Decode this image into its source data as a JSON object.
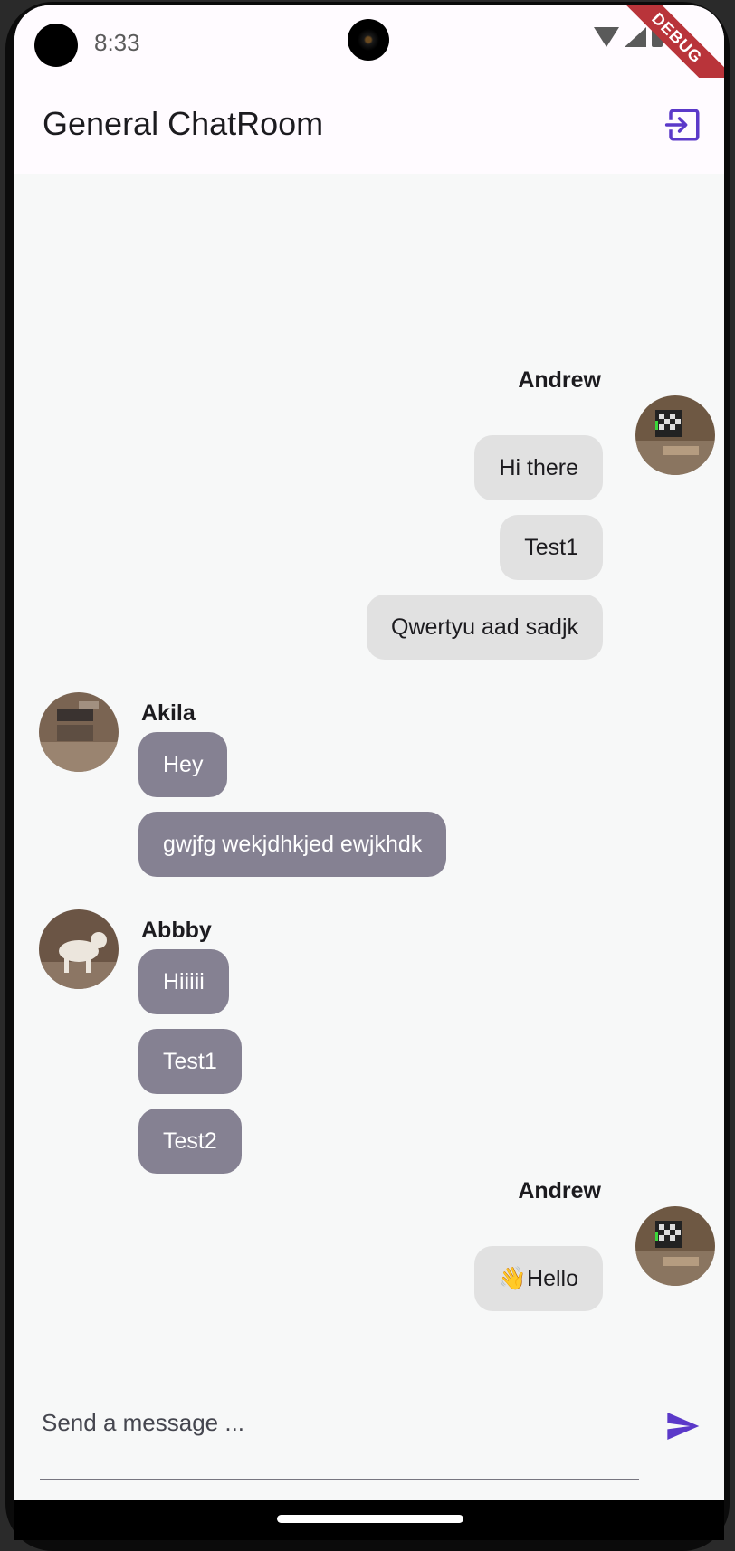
{
  "status_bar": {
    "time": "8:33",
    "debug_label": "DEBUG"
  },
  "app_bar": {
    "title": "General ChatRoom",
    "logout_icon": "logout-icon",
    "accent_color": "#5b39c9"
  },
  "messages": {
    "group1": {
      "sender": "Andrew",
      "texts": [
        "Hi there",
        "Test1",
        "Qwertyu aad sadjk"
      ]
    },
    "group2": {
      "sender": "Akila",
      "texts": [
        "Hey",
        "gwjfg wekjdhkjed ewjkhdk"
      ]
    },
    "group3": {
      "sender": "Abbby",
      "texts": [
        "Hiiiii",
        "Test1",
        "Test2"
      ]
    },
    "group4": {
      "sender": "Andrew",
      "texts": [
        "👋Hello"
      ]
    }
  },
  "input": {
    "placeholder": "Send a message ...",
    "send_icon": "send-icon"
  },
  "colors": {
    "own_bubble": "#e1e1e1",
    "other_bubble": "#858192",
    "background": "#f7f8f8"
  }
}
